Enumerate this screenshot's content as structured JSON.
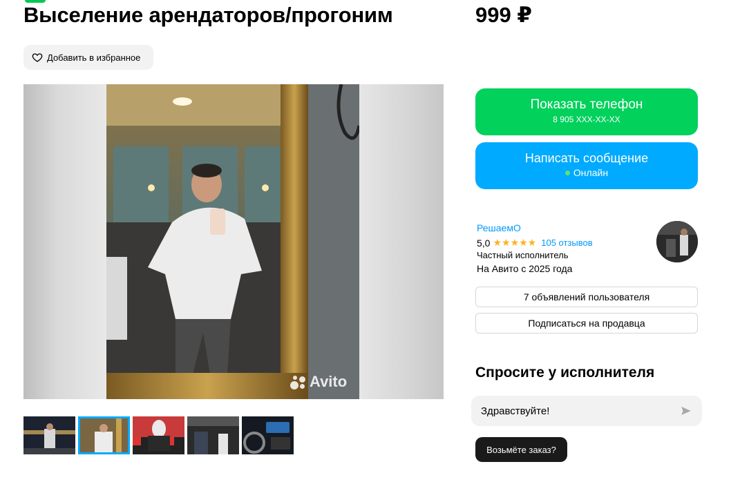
{
  "listing": {
    "title": "Выселение арендаторов/прогоним",
    "price": "999 ₽",
    "favorite_label": "Добавить в избранное"
  },
  "gallery": {
    "watermark": "Avito",
    "thumbnail_count": 5,
    "active_thumbnail": 2
  },
  "contact": {
    "phone_button_label": "Показать телефон",
    "phone_number": "8 905 XXX-XX-XX",
    "message_button_label": "Написать сообщение",
    "status": "Онлайн"
  },
  "seller": {
    "name": "РешаемО",
    "rating": "5,0",
    "stars": "★★★★★",
    "reviews": "105 отзывов",
    "type": "Частный исполнитель",
    "since": "На Авито с 2025 года",
    "ads_button": "7 объявлений пользователя",
    "subscribe_button": "Подписаться на продавца"
  },
  "ask": {
    "title": "Спросите у исполнителя",
    "message_value": "Здравствуйте!",
    "quick_reply": "Возьмёте заказ?"
  },
  "colors": {
    "green_button": "#02d15c",
    "blue_button": "#00aaff",
    "link": "#0099f7",
    "stars": "#ffb021"
  }
}
